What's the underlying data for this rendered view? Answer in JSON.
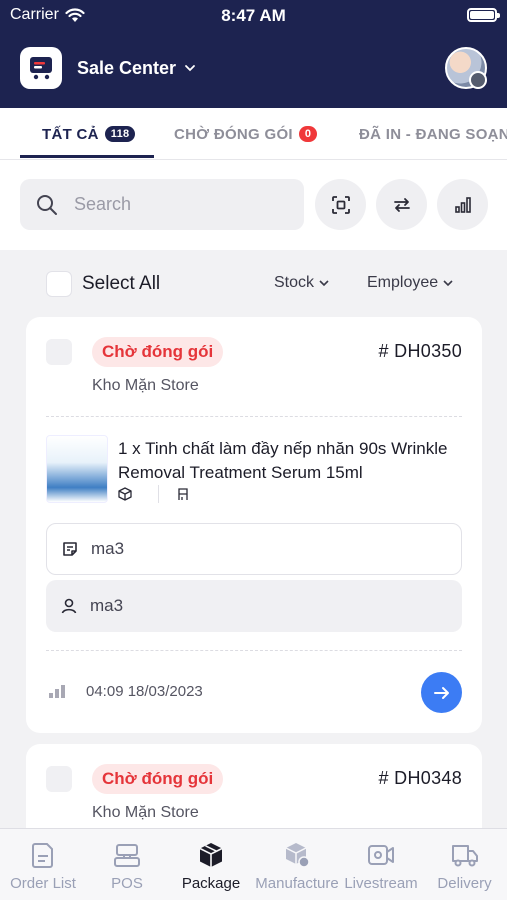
{
  "status_bar": {
    "carrier": "Carrier",
    "time": "8:47 AM"
  },
  "header": {
    "title": "Sale Center"
  },
  "tabs": [
    {
      "label": "TẤT CẢ",
      "count": "118"
    },
    {
      "label": "CHỜ ĐÓNG GÓI",
      "count": "0"
    },
    {
      "label": "ĐÃ IN - ĐANG SOẠN"
    }
  ],
  "search": {
    "placeholder": "Search"
  },
  "filters": {
    "select_all": "Select All",
    "stock": "Stock",
    "employee": "Employee"
  },
  "orders": [
    {
      "status": "Chờ đóng gói",
      "id": "# DH0350",
      "store": "Kho Mặn Store",
      "product": "1 x Tinh chất làm đầy nếp nhăn 90s Wrinkle Removal Treatment Serum 15ml",
      "note": "ma3",
      "employee": "ma3",
      "datetime": "04:09 18/03/2023"
    },
    {
      "status": "Chờ đóng gói",
      "id": "# DH0348",
      "store": "Kho Mặn Store"
    }
  ],
  "bottom_nav": [
    {
      "label": "Order List",
      "icon": "order-list-icon"
    },
    {
      "label": "POS",
      "icon": "pos-icon"
    },
    {
      "label": "Package",
      "icon": "package-icon",
      "active": true
    },
    {
      "label": "Manufacture",
      "icon": "manufacture-icon"
    },
    {
      "label": "Livestream",
      "icon": "livestream-icon"
    },
    {
      "label": "Delivery",
      "icon": "delivery-icon"
    }
  ],
  "colors": {
    "header_bg": "#1d2350",
    "accent_blue": "#3c7cf4",
    "status_red": "#e5353a",
    "status_pill_bg": "#fde7e7"
  }
}
